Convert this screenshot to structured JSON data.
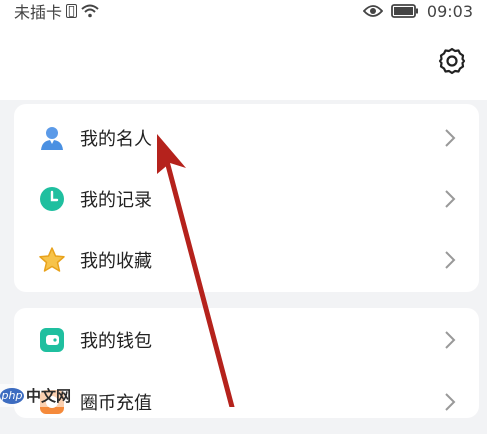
{
  "status_bar": {
    "carrier": "未插卡",
    "time": "09:03",
    "icons": [
      "sim-icon",
      "wifi-icon",
      "eye-icon",
      "battery-icon"
    ]
  },
  "header": {
    "settings_icon": "gear-icon"
  },
  "menu_group_1": [
    {
      "label": "我的名人",
      "icon": "person-icon",
      "icon_color": "#4a90e2"
    },
    {
      "label": "我的记录",
      "icon": "clock-icon",
      "icon_color": "#1fbf9f"
    },
    {
      "label": "我的收藏",
      "icon": "star-icon",
      "icon_color": "#f5b73b"
    }
  ],
  "menu_group_2": [
    {
      "label": "我的钱包",
      "icon": "wallet-icon",
      "icon_color": "#1fbf9f"
    },
    {
      "label": "圈币充值",
      "icon": "coin-icon",
      "icon_color": "#f58a3b"
    }
  ],
  "watermark": {
    "logo": "php",
    "text": "中文网"
  },
  "annotation": {
    "type": "arrow",
    "color": "#b5221c"
  }
}
